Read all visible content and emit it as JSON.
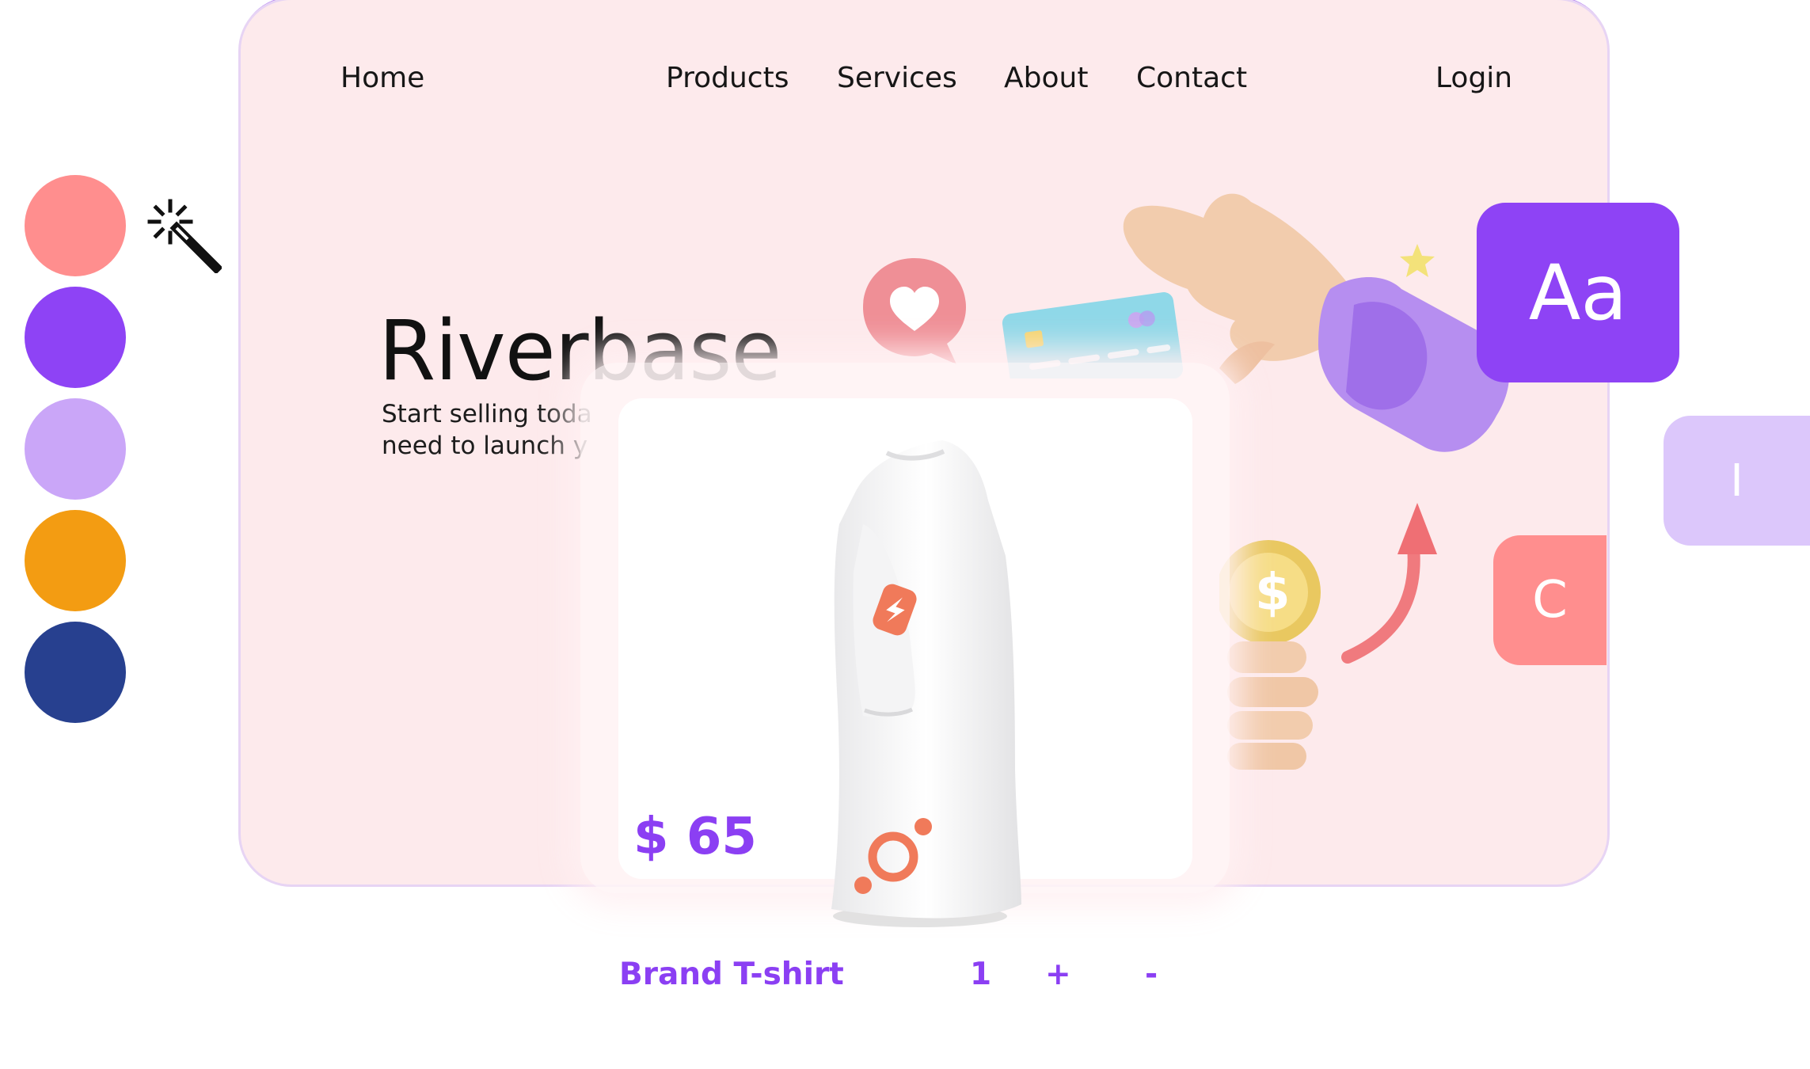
{
  "nav": {
    "home": "Home",
    "products": "Products",
    "services": "Services",
    "about": "About",
    "contact": "Contact",
    "login": "Login"
  },
  "hero": {
    "title": "Riverbase",
    "tagline_line1": "Start selling toda",
    "tagline_line2": "need to launch y"
  },
  "palette": {
    "colors": [
      "#ff8e8e",
      "#8e43f5",
      "#caa6f8",
      "#f39c12",
      "#27408f"
    ]
  },
  "tools": {
    "magic_wand_icon": "magic-wand-icon"
  },
  "font_tiles": {
    "aa": "Aa",
    "i": "I",
    "c": "C"
  },
  "product": {
    "price": "$ 65",
    "name": "Brand T-shirt",
    "quantity": "1",
    "plus": "+",
    "minus": "-"
  },
  "colors": {
    "accent": "#8b3ff3",
    "hero_bg": "#fdeaec",
    "tile_purple": "#8e43f5",
    "tile_lilac": "#dcc7fb",
    "tile_coral": "#ff8e8e"
  }
}
